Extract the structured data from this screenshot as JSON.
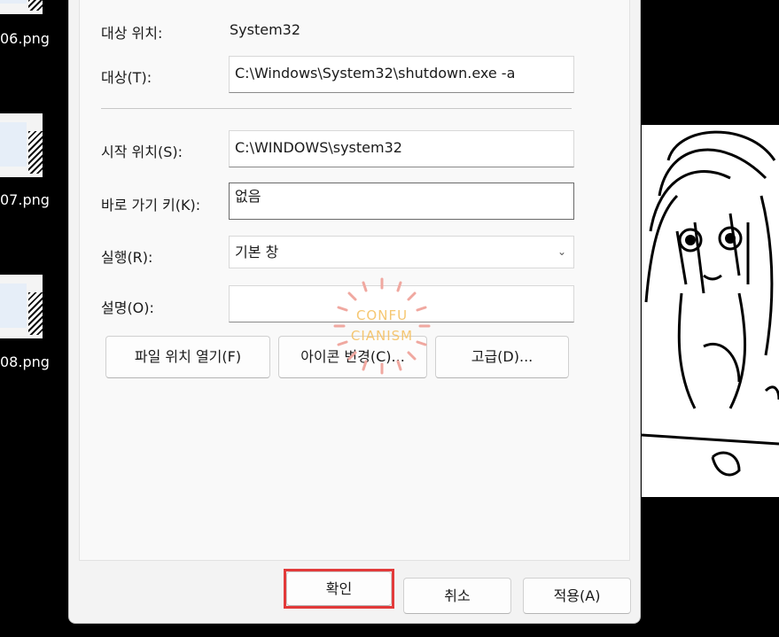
{
  "desktop": {
    "icons": [
      {
        "label": "06.png"
      },
      {
        "label": "07.png"
      },
      {
        "label": "08.png"
      }
    ]
  },
  "dialog": {
    "target_location_label": "대상 위치:",
    "target_location_value": "System32",
    "target_label": "대상(T):",
    "target_value": "C:\\Windows\\System32\\shutdown.exe -a",
    "start_in_label": "시작 위치(S):",
    "start_in_value": "C:\\WINDOWS\\system32",
    "shortcut_key_label": "바로 가기 키(K):",
    "shortcut_key_value": "없음",
    "run_label": "실행(R):",
    "run_value": "기본 창",
    "comment_label": "설명(O):",
    "comment_value": "",
    "open_location_button": "파일 위치 열기(F)",
    "change_icon_button": "아이콘 변경(C)...",
    "advanced_button": "고급(D)...",
    "ok_button": "확인",
    "cancel_button": "취소",
    "apply_button": "적용(A)"
  },
  "watermark": {
    "line1": "CONFU",
    "line2": "CIANISM"
  },
  "colors": {
    "highlight": "#e23a3a",
    "watermark": "#f5c163"
  }
}
